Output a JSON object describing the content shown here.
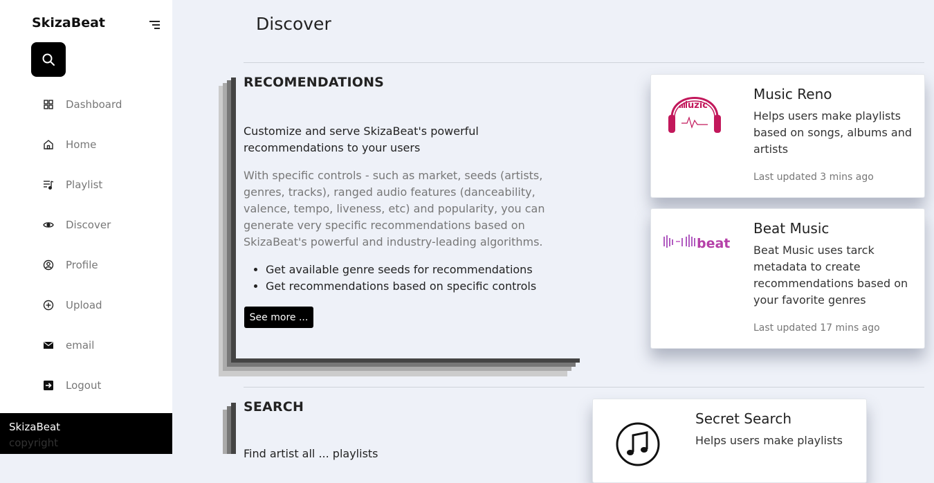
{
  "sidebar": {
    "brand": "SkizaBeat",
    "items": [
      {
        "label": "Dashboard",
        "icon": "grid-icon"
      },
      {
        "label": "Home",
        "icon": "home-icon"
      },
      {
        "label": "Playlist",
        "icon": "playlist-icon"
      },
      {
        "label": "Discover",
        "icon": "eye-icon"
      },
      {
        "label": "Profile",
        "icon": "user-circle-icon"
      },
      {
        "label": "Upload",
        "icon": "plus-circle-icon"
      },
      {
        "label": "email",
        "icon": "mail-icon"
      },
      {
        "label": "Logout",
        "icon": "logout-icon"
      }
    ],
    "footer": {
      "brand": "SkizaBeat",
      "copyright": "copyright"
    }
  },
  "main": {
    "title": "Discover",
    "recommendations": {
      "title": "RECOMENDATIONS",
      "lead": "Customize and serve SkizaBeat's powerful recommendations to your users",
      "description": "With specific controls - such as market, seeds (artists, genres, tracks), ranged audio features (danceability, valence, tempo, liveness, etc) and popularity, you can generate very specific recommendations based on SkizaBeat's powerful and industry-leading algorithms.",
      "bullets": [
        "Get available genre seeds for recommendations",
        "Get recommendations based on specific controls"
      ],
      "button": "See more ..."
    },
    "cards": [
      {
        "title": "Music Reno",
        "description": "Helps users make playlists based on songs, albums and artists",
        "updated": "Last updated 3 mins ago",
        "logo_text": "uzic"
      },
      {
        "title": "Beat Music",
        "description": "Beat Music uses tarck metadata to create recommendations based on your favorite genres",
        "updated": "Last updated 17 mins ago",
        "logo_text": "beat"
      },
      {
        "title": "Secret Search",
        "description": "Helps users make playlists"
      }
    ],
    "search": {
      "title": "SEARCH",
      "lead": "Find",
      "lead_tail": "artist all ... playlists"
    }
  },
  "colors": {
    "background": "#eef1f8",
    "accent_pink": "#c2185b",
    "logo_purple": "#b05bc0"
  }
}
